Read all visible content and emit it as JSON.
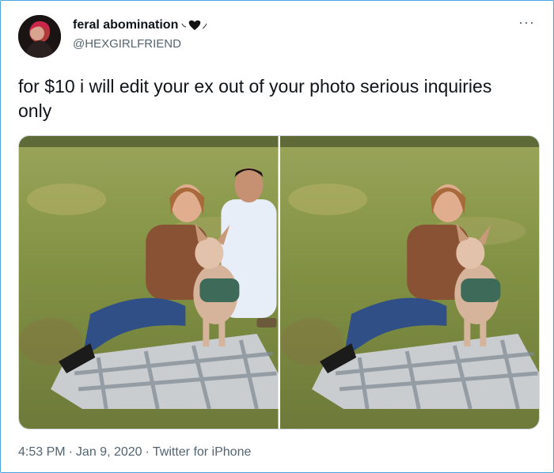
{
  "user": {
    "display_name": "feral abomination",
    "handle": "@HEXGIRLFRIEND",
    "avatar_icon": "avatar-photo"
  },
  "menu": {
    "more_label": "···"
  },
  "tweet": {
    "text": "for $10 i will edit your ex out of your photo serious inquiries only"
  },
  "media": {
    "photos": [
      {
        "name": "original-photo",
        "shows_ex": true
      },
      {
        "name": "edited-photo",
        "shows_ex": false
      }
    ]
  },
  "meta": {
    "time": "4:53 PM",
    "date": "Jan 9, 2020",
    "separator": "·",
    "source": "Twitter for iPhone"
  },
  "colors": {
    "border": "#4aa3df",
    "text_primary": "#0f1419",
    "text_secondary": "#536471"
  }
}
